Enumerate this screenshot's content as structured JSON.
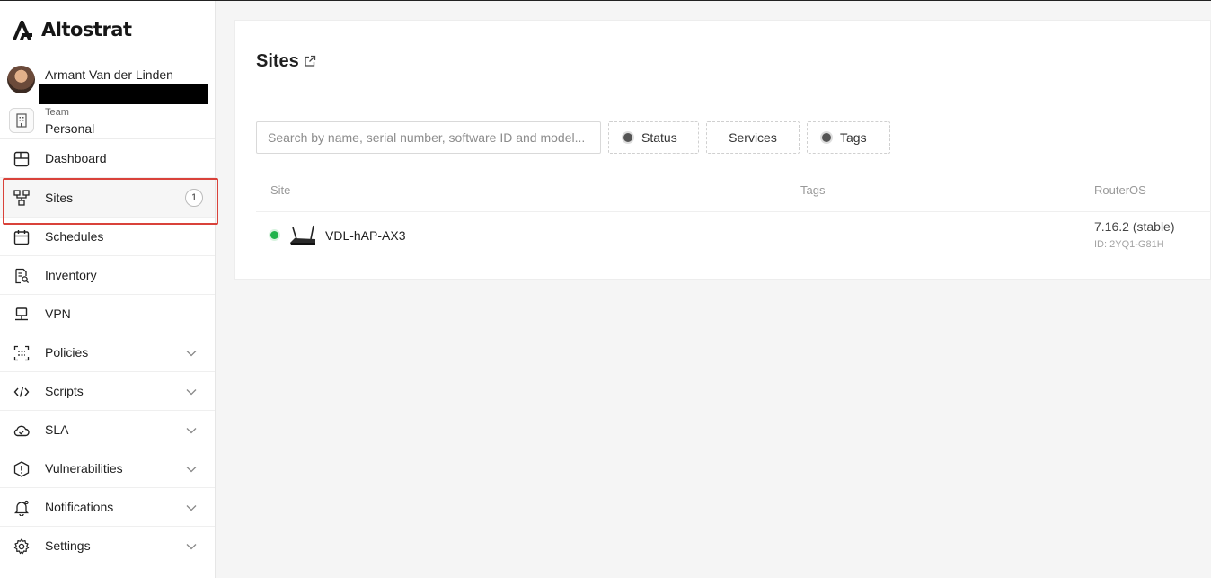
{
  "app": {
    "name": "Altostrat"
  },
  "user": {
    "name": "Armant Van der Linden"
  },
  "team": {
    "label": "Team",
    "value": "Personal"
  },
  "nav": [
    {
      "label": "Dashboard",
      "icon": "dashboard-icon"
    },
    {
      "label": "Sites",
      "icon": "sites-icon",
      "badge": "1",
      "active": true
    },
    {
      "label": "Schedules",
      "icon": "calendar-icon"
    },
    {
      "label": "Inventory",
      "icon": "inventory-icon"
    },
    {
      "label": "VPN",
      "icon": "vpn-icon"
    },
    {
      "label": "Policies",
      "icon": "policies-icon",
      "expandable": true
    },
    {
      "label": "Scripts",
      "icon": "code-icon",
      "expandable": true
    },
    {
      "label": "SLA",
      "icon": "cloud-icon",
      "expandable": true
    },
    {
      "label": "Vulnerabilities",
      "icon": "alert-icon",
      "expandable": true
    },
    {
      "label": "Notifications",
      "icon": "bell-icon",
      "expandable": true
    },
    {
      "label": "Settings",
      "icon": "gear-icon",
      "expandable": true
    }
  ],
  "page": {
    "title": "Sites",
    "search_placeholder": "Search by name, serial number, software ID and model...",
    "filters": {
      "status": "Status",
      "services": "Services",
      "tags": "Tags"
    },
    "columns": {
      "site": "Site",
      "tags": "Tags",
      "routeros": "RouterOS"
    },
    "rows": [
      {
        "status": "online",
        "name": "VDL-hAP-AX3",
        "routeros": "7.16.2 (stable)",
        "id": "ID: 2YQ1-G81H"
      }
    ]
  },
  "colors": {
    "accent_border": "#d9423a",
    "online": "#1fb34a"
  }
}
